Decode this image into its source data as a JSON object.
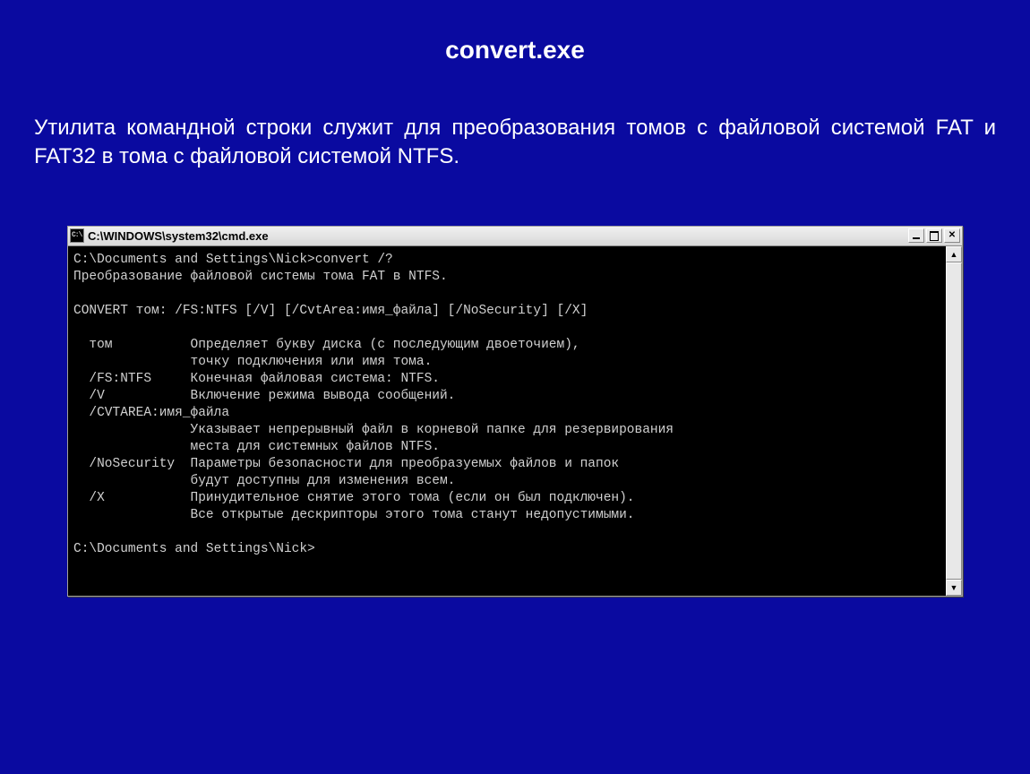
{
  "slide": {
    "title": "convert.exe",
    "description": "Утилита командной строки служит для преобразования томов с файловой системой FAT и FAT32 в тома с файловой системой NTFS."
  },
  "cmd": {
    "title": "C:\\WINDOWS\\system32\\cmd.exe",
    "icon_text": "C:\\",
    "lines": [
      "C:\\Documents and Settings\\Nick>convert /?",
      "Преобразование файловой системы тома FAT в NTFS.",
      "",
      "CONVERT том: /FS:NTFS [/V] [/CvtArea:имя_файла] [/NoSecurity] [/X]",
      "",
      "  том          Определяет букву диска (с последующим двоеточием),",
      "               точку подключения или имя тома.",
      "  /FS:NTFS     Конечная файловая система: NTFS.",
      "  /V           Включение режима вывода сообщений.",
      "  /CVTAREA:имя_файла",
      "               Указывает непрерывный файл в корневой папке для резервирования",
      "               места для системных файлов NTFS.",
      "  /NoSecurity  Параметры безопасности для преобразуемых файлов и папок",
      "               будут доступны для изменения всем.",
      "  /X           Принудительное снятие этого тома (если он был подключен).",
      "               Все открытые дескрипторы этого тома станут недопустимыми.",
      "",
      "C:\\Documents and Settings\\Nick>"
    ]
  }
}
